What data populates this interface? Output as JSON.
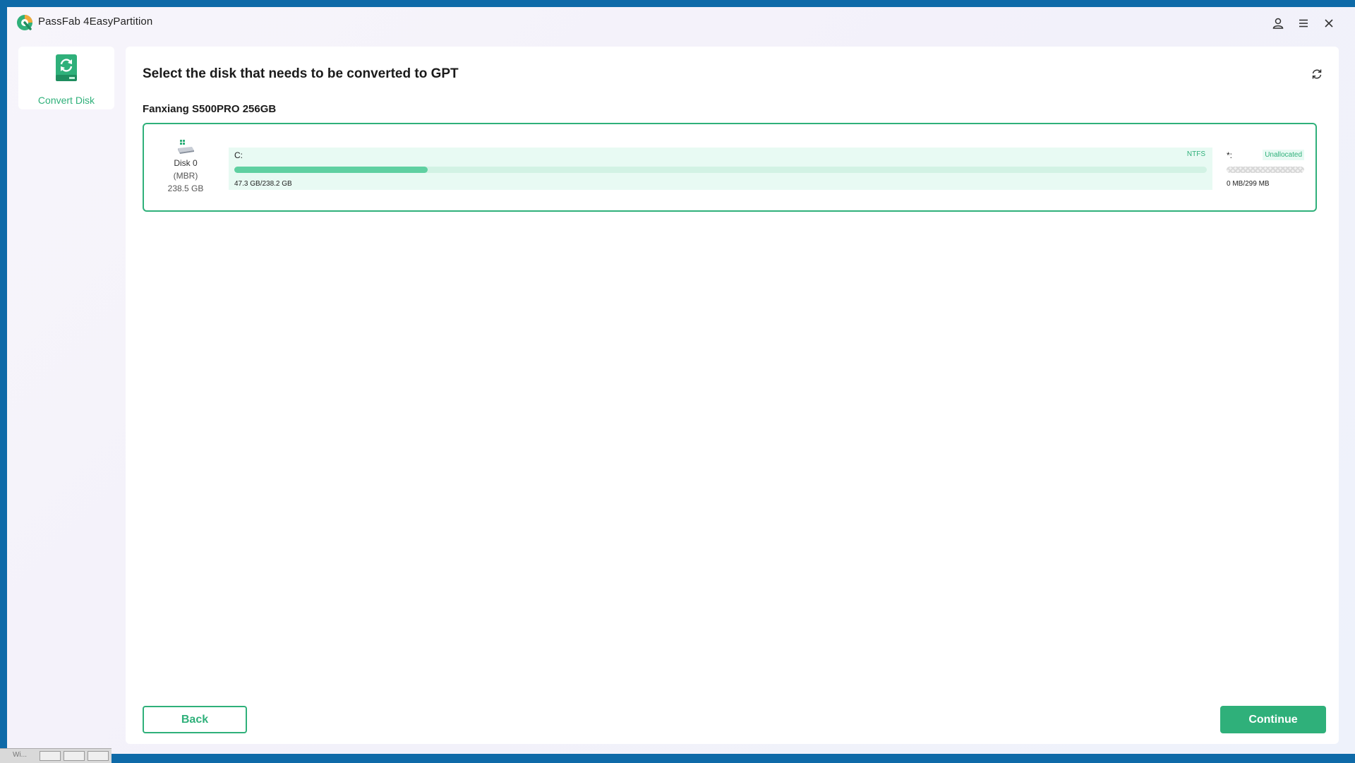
{
  "app": {
    "title": "PassFab 4EasyPartition",
    "icons": {
      "logo": "app-logo",
      "account": "user-icon",
      "menu": "hamburger-menu-icon",
      "close": "close-icon"
    },
    "accent": "#2fb07a"
  },
  "sidebar": {
    "items": [
      {
        "label": "Convert Disk",
        "icon": "convert-disk-icon",
        "selected": true
      }
    ]
  },
  "main": {
    "title": "Select the disk that needs to be converted to GPT",
    "refresh_icon": "refresh-icon",
    "disk_model": "Fanxiang S500PRO 256GB",
    "disk": {
      "name": "Disk 0",
      "style": "(MBR)",
      "size": "238.5 GB",
      "partitions": [
        {
          "letter": "C:",
          "filesystem": "NTFS",
          "usage": "47.3 GB/238.2 GB",
          "used_fraction": 0.199
        },
        {
          "letter": "*:",
          "filesystem": "Unallocated",
          "usage": "0 MB/299 MB",
          "used_fraction": 0
        }
      ]
    }
  },
  "footer": {
    "back_label": "Back",
    "continue_label": "Continue"
  },
  "taskbar": {
    "text": "Wi..."
  }
}
